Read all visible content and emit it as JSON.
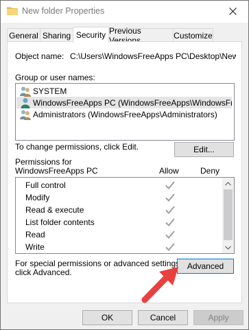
{
  "window": {
    "title": "New folder Properties"
  },
  "tabs": [
    {
      "label": "General"
    },
    {
      "label": "Sharing"
    },
    {
      "label": "Security",
      "active": true
    },
    {
      "label": "Previous Versions"
    },
    {
      "label": "Customize"
    }
  ],
  "object": {
    "label": "Object name:",
    "value": "C:\\Users\\WindowsFreeApps PC\\Desktop\\New fol"
  },
  "groups": {
    "label": "Group or user names:",
    "items": [
      {
        "name": "SYSTEM",
        "icon": "users-group-icon",
        "selected": false
      },
      {
        "name": "WindowsFreeApps PC (WindowsFreeApps\\WindowsFreeA...",
        "icon": "user-icon",
        "selected": true
      },
      {
        "name": "Administrators (WindowsFreeApps\\Administrators)",
        "icon": "users-group-icon",
        "selected": false
      }
    ]
  },
  "change_text": "To change permissions, click Edit.",
  "edit_label": "Edit...",
  "permissions": {
    "label_line1": "Permissions for",
    "label_line2": "WindowsFreeApps PC",
    "allow_label": "Allow",
    "deny_label": "Deny",
    "rows": [
      {
        "name": "Full control",
        "allow": true,
        "deny": false
      },
      {
        "name": "Modify",
        "allow": true,
        "deny": false
      },
      {
        "name": "Read & execute",
        "allow": true,
        "deny": false
      },
      {
        "name": "List folder contents",
        "allow": true,
        "deny": false
      },
      {
        "name": "Read",
        "allow": true,
        "deny": false
      },
      {
        "name": "Write",
        "allow": true,
        "deny": false
      }
    ]
  },
  "advanced_text_line1": "For special permissions or advanced settings,",
  "advanced_text_line2": "click Advanced.",
  "advanced_label": "Advanced",
  "footer": {
    "ok_label": "OK",
    "cancel_label": "Cancel",
    "apply_label": "Apply"
  },
  "colors": {
    "accent": "#0078d7",
    "annotation_arrow": "#e8403f",
    "check": "#a0a0a0"
  }
}
